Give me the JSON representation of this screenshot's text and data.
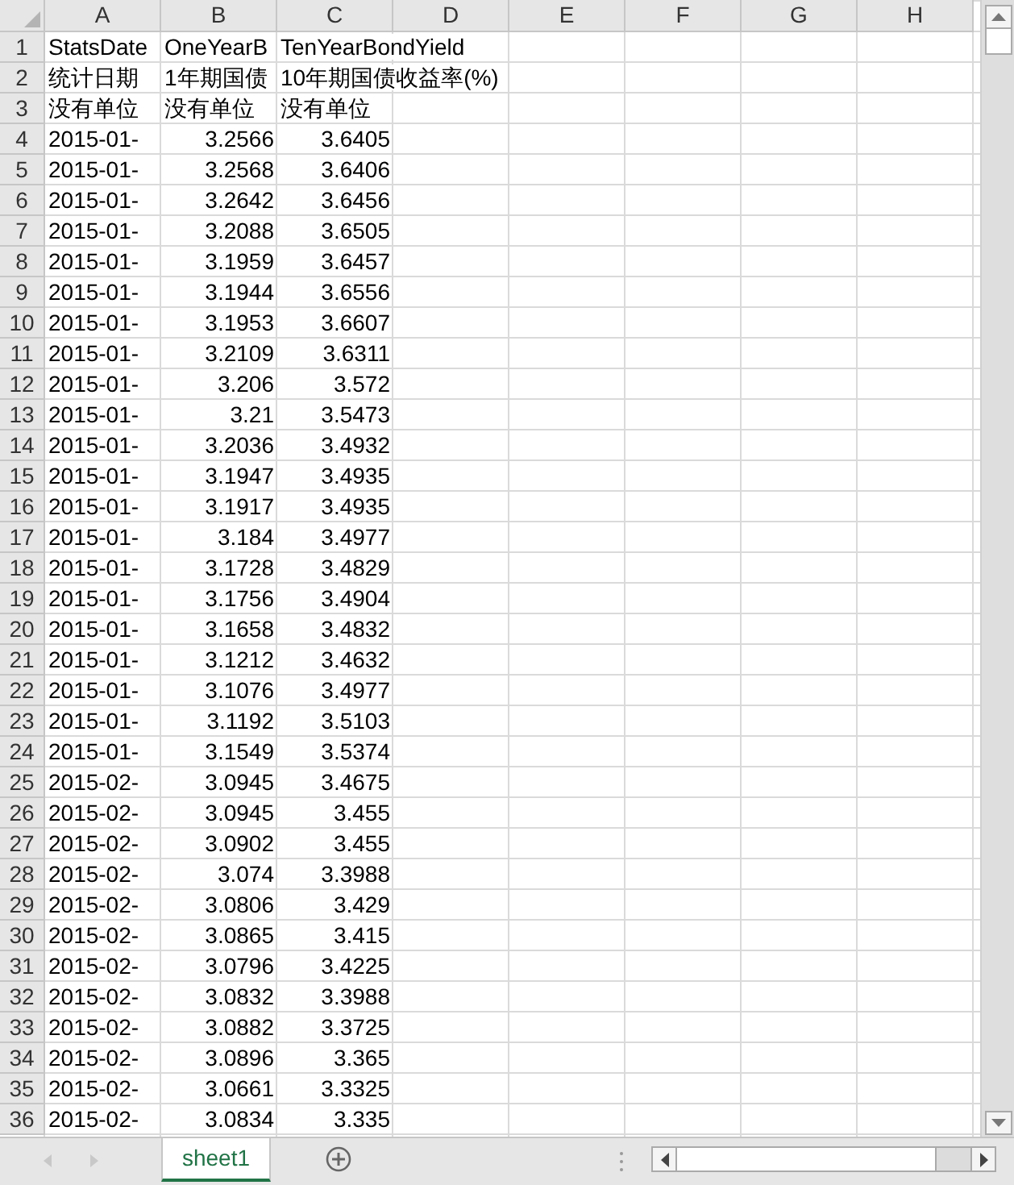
{
  "columns": [
    "A",
    "B",
    "C",
    "D",
    "E",
    "F",
    "G",
    "H"
  ],
  "rows": [
    {
      "num": "1",
      "kind": "text",
      "cells": [
        "StatsDate",
        "OneYearB",
        "TenYearBondYield"
      ]
    },
    {
      "num": "2",
      "kind": "text",
      "cells": [
        "统计日期",
        "1年期国债",
        "10年期国债收益率(%)"
      ]
    },
    {
      "num": "3",
      "kind": "text",
      "cells": [
        "没有单位",
        "没有单位",
        "没有单位"
      ]
    },
    {
      "num": "4",
      "kind": "number",
      "cells": [
        "2015-01-",
        "3.2566",
        "3.6405"
      ]
    },
    {
      "num": "5",
      "kind": "number",
      "cells": [
        "2015-01-",
        "3.2568",
        "3.6406"
      ]
    },
    {
      "num": "6",
      "kind": "number",
      "cells": [
        "2015-01-",
        "3.2642",
        "3.6456"
      ]
    },
    {
      "num": "7",
      "kind": "number",
      "cells": [
        "2015-01-",
        "3.2088",
        "3.6505"
      ]
    },
    {
      "num": "8",
      "kind": "number",
      "cells": [
        "2015-01-",
        "3.1959",
        "3.6457"
      ]
    },
    {
      "num": "9",
      "kind": "number",
      "cells": [
        "2015-01-",
        "3.1944",
        "3.6556"
      ]
    },
    {
      "num": "10",
      "kind": "number",
      "cells": [
        "2015-01-",
        "3.1953",
        "3.6607"
      ]
    },
    {
      "num": "11",
      "kind": "number",
      "cells": [
        "2015-01-",
        "3.2109",
        "3.6311"
      ]
    },
    {
      "num": "12",
      "kind": "number",
      "cells": [
        "2015-01-",
        "3.206",
        "3.572"
      ]
    },
    {
      "num": "13",
      "kind": "number",
      "cells": [
        "2015-01-",
        "3.21",
        "3.5473"
      ]
    },
    {
      "num": "14",
      "kind": "number",
      "cells": [
        "2015-01-",
        "3.2036",
        "3.4932"
      ]
    },
    {
      "num": "15",
      "kind": "number",
      "cells": [
        "2015-01-",
        "3.1947",
        "3.4935"
      ]
    },
    {
      "num": "16",
      "kind": "number",
      "cells": [
        "2015-01-",
        "3.1917",
        "3.4935"
      ]
    },
    {
      "num": "17",
      "kind": "number",
      "cells": [
        "2015-01-",
        "3.184",
        "3.4977"
      ]
    },
    {
      "num": "18",
      "kind": "number",
      "cells": [
        "2015-01-",
        "3.1728",
        "3.4829"
      ]
    },
    {
      "num": "19",
      "kind": "number",
      "cells": [
        "2015-01-",
        "3.1756",
        "3.4904"
      ]
    },
    {
      "num": "20",
      "kind": "number",
      "cells": [
        "2015-01-",
        "3.1658",
        "3.4832"
      ]
    },
    {
      "num": "21",
      "kind": "number",
      "cells": [
        "2015-01-",
        "3.1212",
        "3.4632"
      ]
    },
    {
      "num": "22",
      "kind": "number",
      "cells": [
        "2015-01-",
        "3.1076",
        "3.4977"
      ]
    },
    {
      "num": "23",
      "kind": "number",
      "cells": [
        "2015-01-",
        "3.1192",
        "3.5103"
      ]
    },
    {
      "num": "24",
      "kind": "number",
      "cells": [
        "2015-01-",
        "3.1549",
        "3.5374"
      ]
    },
    {
      "num": "25",
      "kind": "number",
      "cells": [
        "2015-02-",
        "3.0945",
        "3.4675"
      ]
    },
    {
      "num": "26",
      "kind": "number",
      "cells": [
        "2015-02-",
        "3.0945",
        "3.455"
      ]
    },
    {
      "num": "27",
      "kind": "number",
      "cells": [
        "2015-02-",
        "3.0902",
        "3.455"
      ]
    },
    {
      "num": "28",
      "kind": "number",
      "cells": [
        "2015-02-",
        "3.074",
        "3.3988"
      ]
    },
    {
      "num": "29",
      "kind": "number",
      "cells": [
        "2015-02-",
        "3.0806",
        "3.429"
      ]
    },
    {
      "num": "30",
      "kind": "number",
      "cells": [
        "2015-02-",
        "3.0865",
        "3.415"
      ]
    },
    {
      "num": "31",
      "kind": "number",
      "cells": [
        "2015-02-",
        "3.0796",
        "3.4225"
      ]
    },
    {
      "num": "32",
      "kind": "number",
      "cells": [
        "2015-02-",
        "3.0832",
        "3.3988"
      ]
    },
    {
      "num": "33",
      "kind": "number",
      "cells": [
        "2015-02-",
        "3.0882",
        "3.3725"
      ]
    },
    {
      "num": "34",
      "kind": "number",
      "cells": [
        "2015-02-",
        "3.0896",
        "3.365"
      ]
    },
    {
      "num": "35",
      "kind": "number",
      "cells": [
        "2015-02-",
        "3.0661",
        "3.3325"
      ]
    },
    {
      "num": "36",
      "kind": "number",
      "cells": [
        "2015-02-",
        "3.0834",
        "3.335"
      ]
    }
  ],
  "sheet_tabs": [
    {
      "label": "sheet1",
      "selected": true
    }
  ]
}
